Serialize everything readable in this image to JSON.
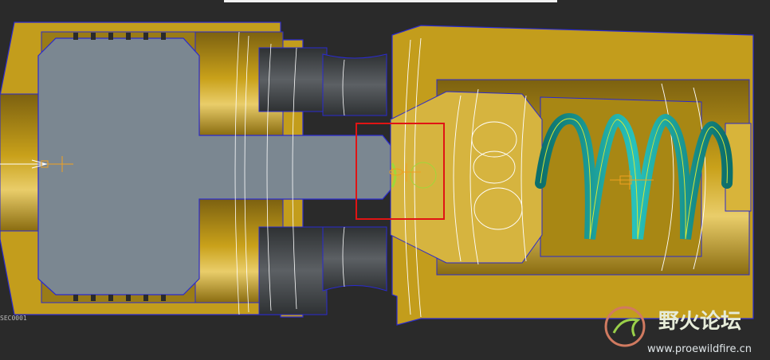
{
  "viewport": {
    "section_label": "SEC0001",
    "watermark_name": "野火论坛",
    "watermark_url": "www.proewildfire.cn"
  },
  "colors": {
    "background": "#2a2a2a",
    "brass": "#c9a11a",
    "brass_dark": "#8e7010",
    "brass_light": "#e2c25a",
    "piston": "#7b8791",
    "steel": "#4f5357",
    "spring": "#149e99",
    "edge": "#2a2ad0",
    "selection": "#e01414",
    "datum": "#f0a020",
    "datum_green": "#9fd83a"
  }
}
